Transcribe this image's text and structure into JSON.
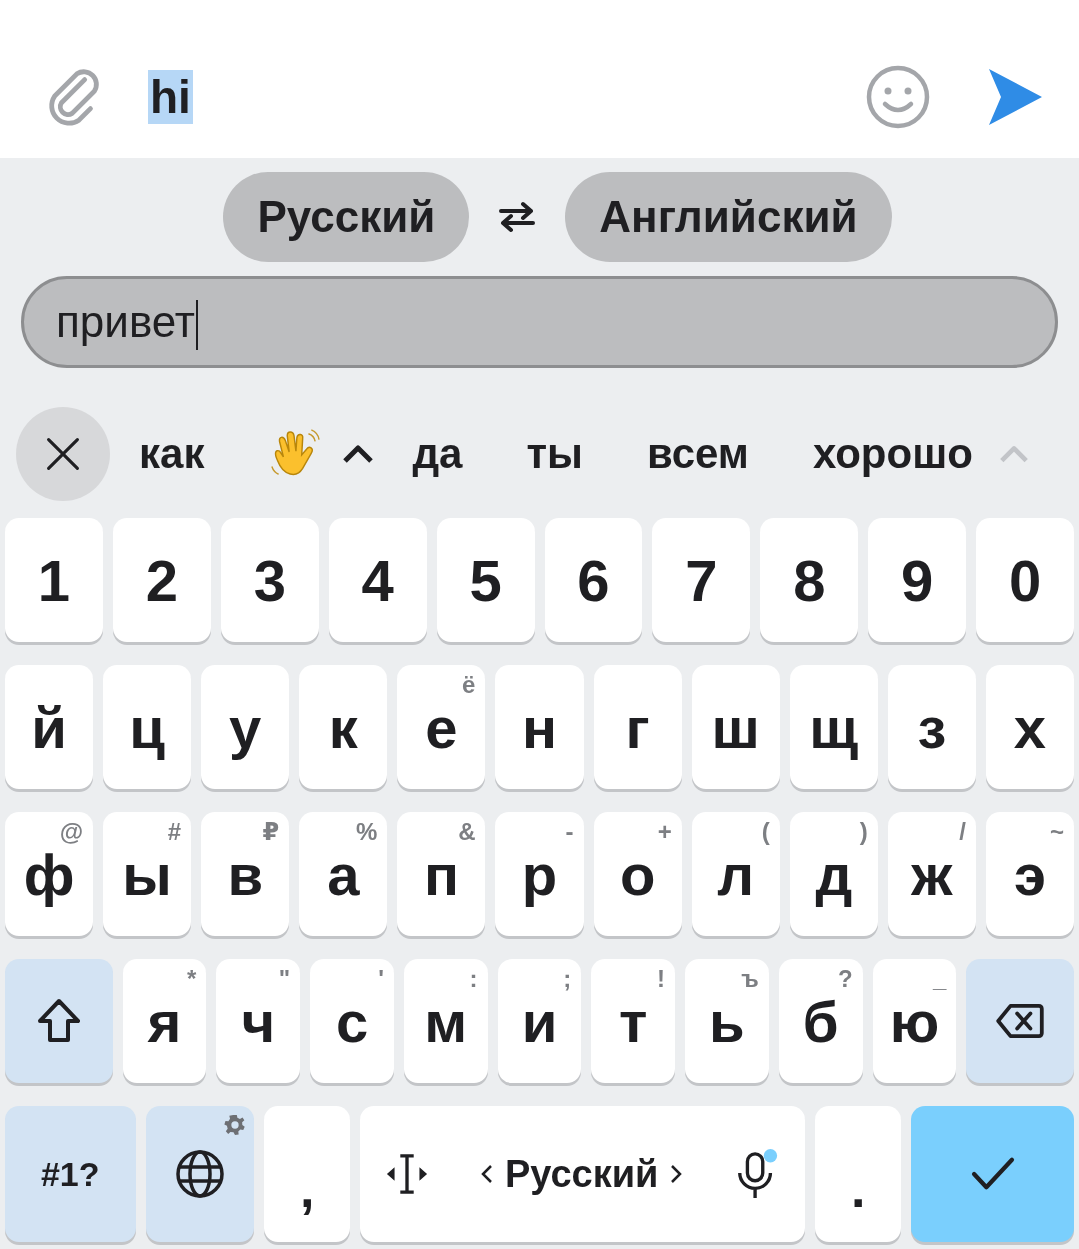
{
  "message_bar": {
    "text": "hi",
    "selected": true
  },
  "languages": {
    "source": "Русский",
    "target": "Английский"
  },
  "translate_field": {
    "value": "привет"
  },
  "suggestions": [
    {
      "kind": "close"
    },
    {
      "kind": "word",
      "text": "как"
    },
    {
      "kind": "emoji"
    },
    {
      "kind": "expand"
    },
    {
      "kind": "word",
      "text": "да"
    },
    {
      "kind": "word",
      "text": "ты"
    },
    {
      "kind": "word",
      "text": "всем"
    },
    {
      "kind": "word",
      "text": "хорошо"
    },
    {
      "kind": "more"
    }
  ],
  "keyboard": {
    "rows": [
      {
        "keys": [
          {
            "kind": "char",
            "label": "1"
          },
          {
            "kind": "char",
            "label": "2"
          },
          {
            "kind": "char",
            "label": "3"
          },
          {
            "kind": "char",
            "label": "4"
          },
          {
            "kind": "char",
            "label": "5"
          },
          {
            "kind": "char",
            "label": "6"
          },
          {
            "kind": "char",
            "label": "7"
          },
          {
            "kind": "char",
            "label": "8"
          },
          {
            "kind": "char",
            "label": "9"
          },
          {
            "kind": "char",
            "label": "0"
          }
        ]
      },
      {
        "keys": [
          {
            "kind": "char",
            "label": "й"
          },
          {
            "kind": "char",
            "label": "ц"
          },
          {
            "kind": "char",
            "label": "у"
          },
          {
            "kind": "char",
            "label": "к"
          },
          {
            "kind": "char",
            "label": "е",
            "hint": "ё"
          },
          {
            "kind": "char",
            "label": "н"
          },
          {
            "kind": "char",
            "label": "г"
          },
          {
            "kind": "char",
            "label": "ш"
          },
          {
            "kind": "char",
            "label": "щ"
          },
          {
            "kind": "char",
            "label": "з"
          },
          {
            "kind": "char",
            "label": "х"
          }
        ]
      },
      {
        "keys": [
          {
            "kind": "char",
            "label": "ф",
            "hint": "@"
          },
          {
            "kind": "char",
            "label": "ы",
            "hint": "#"
          },
          {
            "kind": "char",
            "label": "в",
            "hint": "₽"
          },
          {
            "kind": "char",
            "label": "а",
            "hint": "%"
          },
          {
            "kind": "char",
            "label": "п",
            "hint": "&"
          },
          {
            "kind": "char",
            "label": "р",
            "hint": "-"
          },
          {
            "kind": "char",
            "label": "о",
            "hint": "+"
          },
          {
            "kind": "char",
            "label": "л",
            "hint": "("
          },
          {
            "kind": "char",
            "label": "д",
            "hint": ")"
          },
          {
            "kind": "char",
            "label": "ж",
            "hint": "/"
          },
          {
            "kind": "char",
            "label": "э",
            "hint": "~"
          }
        ]
      },
      {
        "keys": [
          {
            "kind": "shift"
          },
          {
            "kind": "char",
            "label": "я",
            "hint": "*"
          },
          {
            "kind": "char",
            "label": "ч",
            "hint": "\""
          },
          {
            "kind": "char",
            "label": "с",
            "hint": "'"
          },
          {
            "kind": "char",
            "label": "м",
            "hint": ":"
          },
          {
            "kind": "char",
            "label": "и",
            "hint": ";"
          },
          {
            "kind": "char",
            "label": "т",
            "hint": "!"
          },
          {
            "kind": "char",
            "label": "ь",
            "hint": "ъ"
          },
          {
            "kind": "char",
            "label": "б",
            "hint": "?"
          },
          {
            "kind": "char",
            "label": "ю",
            "hint": "_"
          },
          {
            "kind": "backspace"
          }
        ]
      },
      {
        "keys": [
          {
            "kind": "symbols",
            "label": "#1?"
          },
          {
            "kind": "globe"
          },
          {
            "kind": "punct",
            "label": ","
          },
          {
            "kind": "space",
            "label": "Русский"
          },
          {
            "kind": "punct",
            "label": "."
          },
          {
            "kind": "enter"
          }
        ]
      }
    ]
  }
}
